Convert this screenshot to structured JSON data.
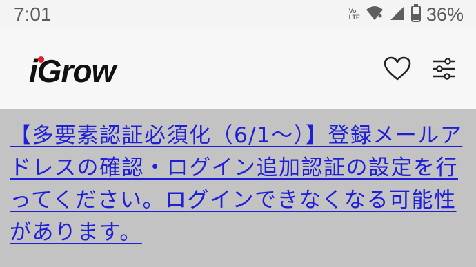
{
  "status_bar": {
    "time": "7:01",
    "network_label_top": "Vo",
    "network_label_bottom": "LTE",
    "battery_percent": "36%"
  },
  "header": {
    "logo": "iGrow",
    "icons": [
      "heart-icon",
      "filter-sliders-icon"
    ]
  },
  "notice": {
    "text": "【多要素認証必須化（6/1〜）】登録メールアドレスの確認・ログイン追加認証の設定を行ってください。ログインできなくなる可能性があります。"
  },
  "colors": {
    "link": "#1f1fd8",
    "notice_background": "#c3c3c3",
    "logo_dot": "#e0202a"
  }
}
